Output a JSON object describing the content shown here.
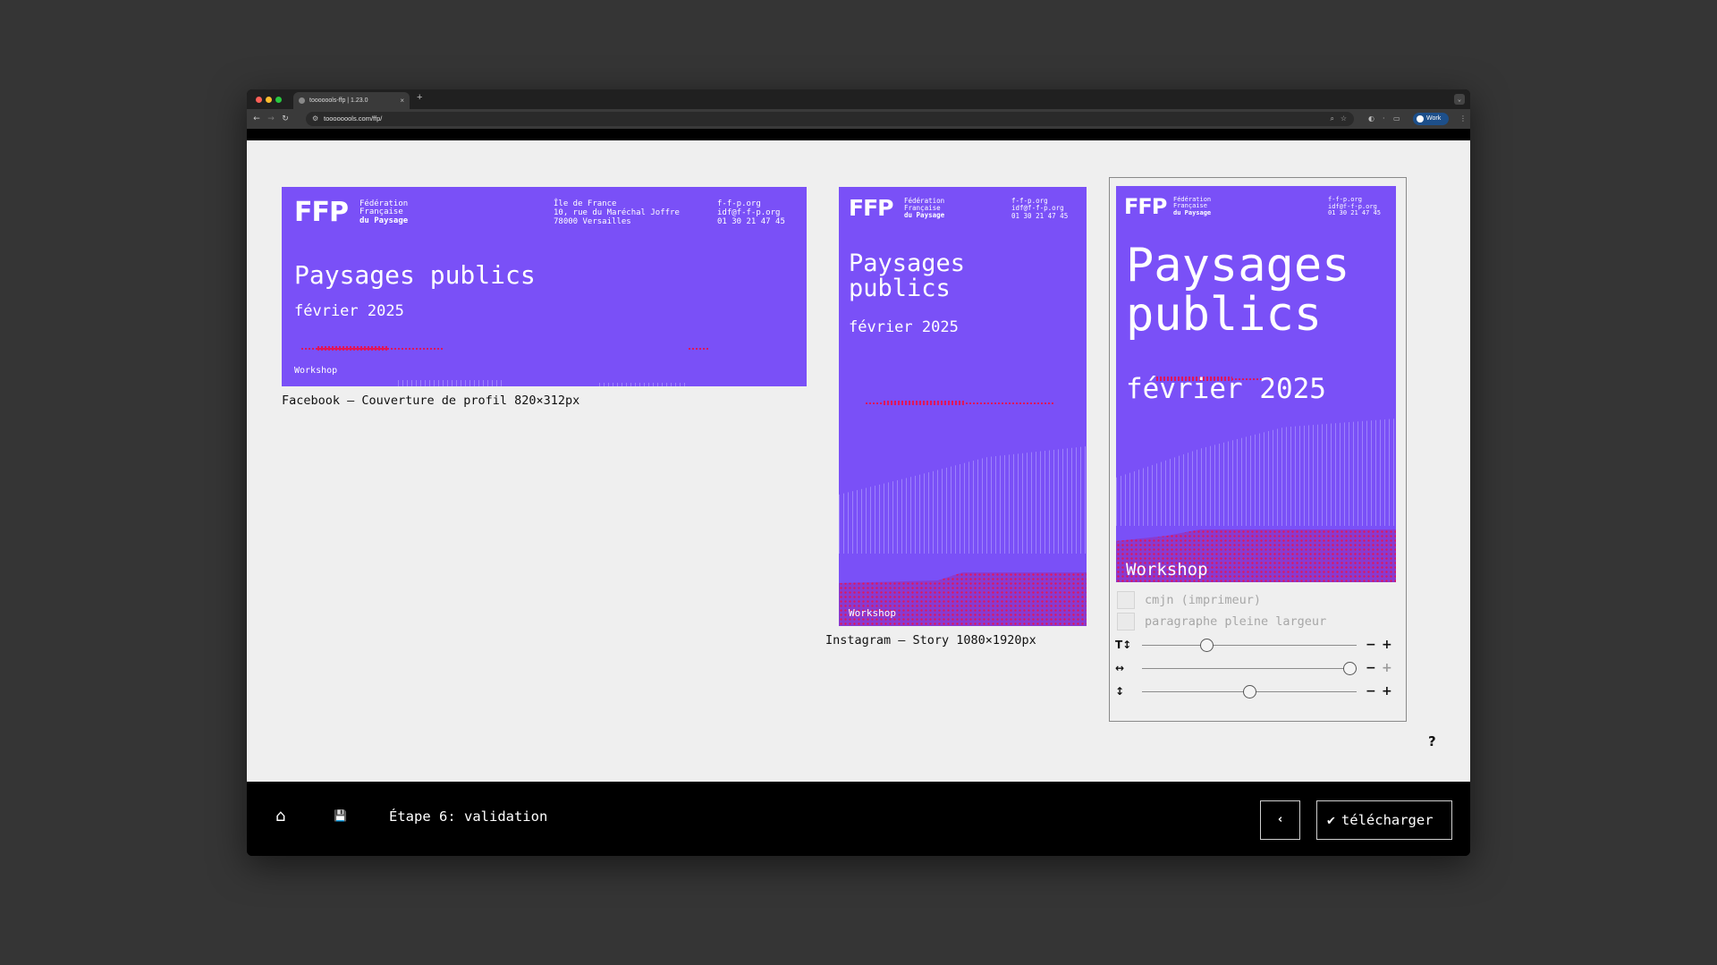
{
  "browser": {
    "tab_title": "tooooools-ffp | 1.23.0",
    "tab_close": "×",
    "new_tab": "+",
    "url": "toooooools.com/ffp/",
    "profile": "Work"
  },
  "colors": {
    "card_bg": "#7a50f7",
    "accent_red": "#e0155a",
    "app_bg": "#efefef",
    "footer_bg": "#000000"
  },
  "poster": {
    "logo": "FFP",
    "org": [
      "Fédération",
      "Française",
      "du Paysage"
    ],
    "address": [
      "Île de France",
      "10, rue du Maréchal Joffre",
      "78000 Versailles"
    ],
    "contact": [
      "f-f-p.org",
      "idf@f-f-p.org",
      "01 30 21 47 45"
    ],
    "title": "Paysages publics",
    "title_line1": "Paysages",
    "title_line2": "publics",
    "date": "février 2025",
    "tag": "Workshop"
  },
  "formats": [
    {
      "caption": "Facebook — Couverture de profil 820×312px"
    },
    {
      "caption": "Instagram — Story 1080×1920px"
    }
  ],
  "panel": {
    "options": [
      {
        "label": "cmjn (imprimeur)",
        "checked": false
      },
      {
        "label": "paragraphe pleine largeur",
        "checked": false
      }
    ],
    "sliders": [
      {
        "icon": "text-size-icon",
        "glyph": "T↕",
        "value": 0.3
      },
      {
        "icon": "width-icon",
        "glyph": "↔",
        "value": 0.97
      },
      {
        "icon": "height-icon",
        "glyph": "↕",
        "value": 0.5
      }
    ],
    "minus": "−",
    "plus": "+"
  },
  "help": "?",
  "footer": {
    "home_icon": "⌂",
    "save_icon": "💾",
    "step": "Étape 6: validation",
    "back": "‹",
    "download_check": "✔",
    "download": "télécharger"
  }
}
